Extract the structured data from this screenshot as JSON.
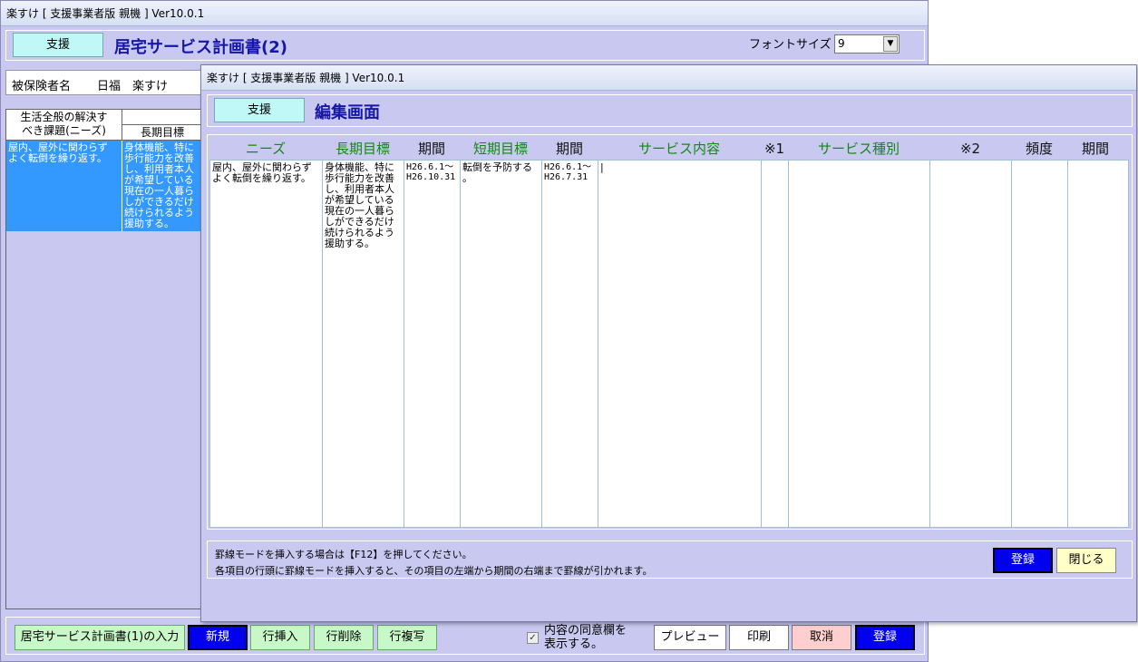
{
  "back_window": {
    "title": "楽すけ [ 支援事業者版 親機 ] Ver10.0.1",
    "mode_button": "支援",
    "form_title": "居宅サービス計画書(2)",
    "font_size_label": "フォントサイズ",
    "font_size_value": "9",
    "insured_label": "被保険者名",
    "insured_name": "日福　楽すけ",
    "grid": {
      "needs_header": "生活全般の解決す\nべき課題(ニーズ)",
      "long_goal_header": "長期目標",
      "needs_cell": "屋内、屋外に関わらず\nよく転倒を繰り返す。",
      "long_goal_cell": "身体機能、特に\n歩行能力を改善\nし、利用者本人\nが希望している\n現在の一人暮ら\nしができるだけ\n続けられるよう\n援助する。"
    },
    "footer": {
      "plan1_button": "居宅サービス計画書(1)の入力",
      "new_button": "新規",
      "insert_row_button": "行挿入",
      "delete_row_button": "行削除",
      "copy_row_button": "行複写",
      "consent_checked": true,
      "consent_label": "内容の同意欄を\n表示する。",
      "preview_button": "プレビュー",
      "print_button": "印刷",
      "cancel_button": "取消",
      "register_button": "登録"
    }
  },
  "front_window": {
    "title": "楽すけ [ 支援事業者版 親機 ] Ver10.0.1",
    "mode_button": "支援",
    "form_title": "編集画面",
    "columns": {
      "needs": "ニーズ",
      "long_goal": "長期目標",
      "long_period": "期間",
      "short_goal": "短期目標",
      "short_period": "期間",
      "service": "サービス内容",
      "note1": "※1",
      "service_type": "サービス種別",
      "note2": "※2",
      "frequency": "頻度",
      "period": "期間"
    },
    "row": {
      "needs": "屋内、屋外に関わらず\nよく転倒を繰り返す。",
      "long_goal": "身体機能、特に\n歩行能力を改善\nし、利用者本人\nが希望している\n現在の一人暮ら\nしができるだけ\n続けられるよう\n援助する。",
      "long_period": "H26.6.1～\nH26.10.31",
      "short_goal": "転倒を予防する\n。",
      "short_period": "H26.6.1～\nH26.7.31",
      "service": "|",
      "note1": "",
      "service_type": "",
      "note2": "",
      "frequency": "",
      "period": ""
    },
    "notice_line1": "罫線モードを挿入する場合は【F12】を押してください。",
    "notice_line2": "各項目の行頭に罫線モードを挿入すると、その項目の左端から期間の右端まで罫線が引かれます。",
    "register_button": "登録",
    "close_button": "閉じる"
  }
}
